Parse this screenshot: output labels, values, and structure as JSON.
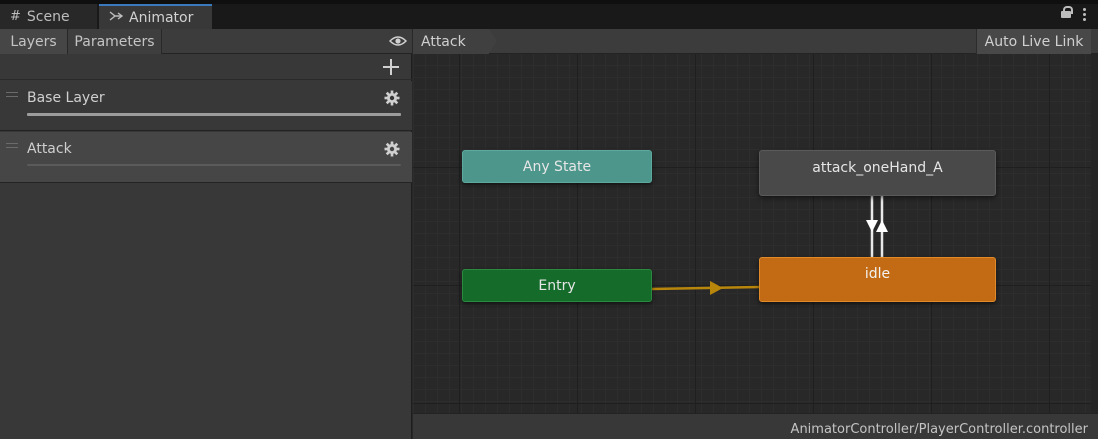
{
  "tabs": [
    {
      "label": "Scene",
      "icon": "grid-icon"
    },
    {
      "label": "Animator",
      "icon": "animator-icon"
    }
  ],
  "left_panel": {
    "toolbar": {
      "layers_label": "Layers",
      "parameters_label": "Parameters"
    },
    "layers": [
      {
        "name": "Base Layer"
      },
      {
        "name": "Attack"
      }
    ]
  },
  "graph": {
    "breadcrumb": "Attack",
    "live_link_label": "Auto Live Link",
    "states": {
      "any_state": "Any State",
      "entry": "Entry",
      "attack": "attack_oneHand_A",
      "idle": "idle"
    },
    "status_path": "AnimatorController/PlayerController.controller"
  },
  "colors": {
    "any_state": "#4d968b",
    "entry": "#146b2a",
    "default_state": "#c26b14",
    "state": "#494949",
    "default_transition": "#b8860b",
    "transition": "#ffffff"
  }
}
